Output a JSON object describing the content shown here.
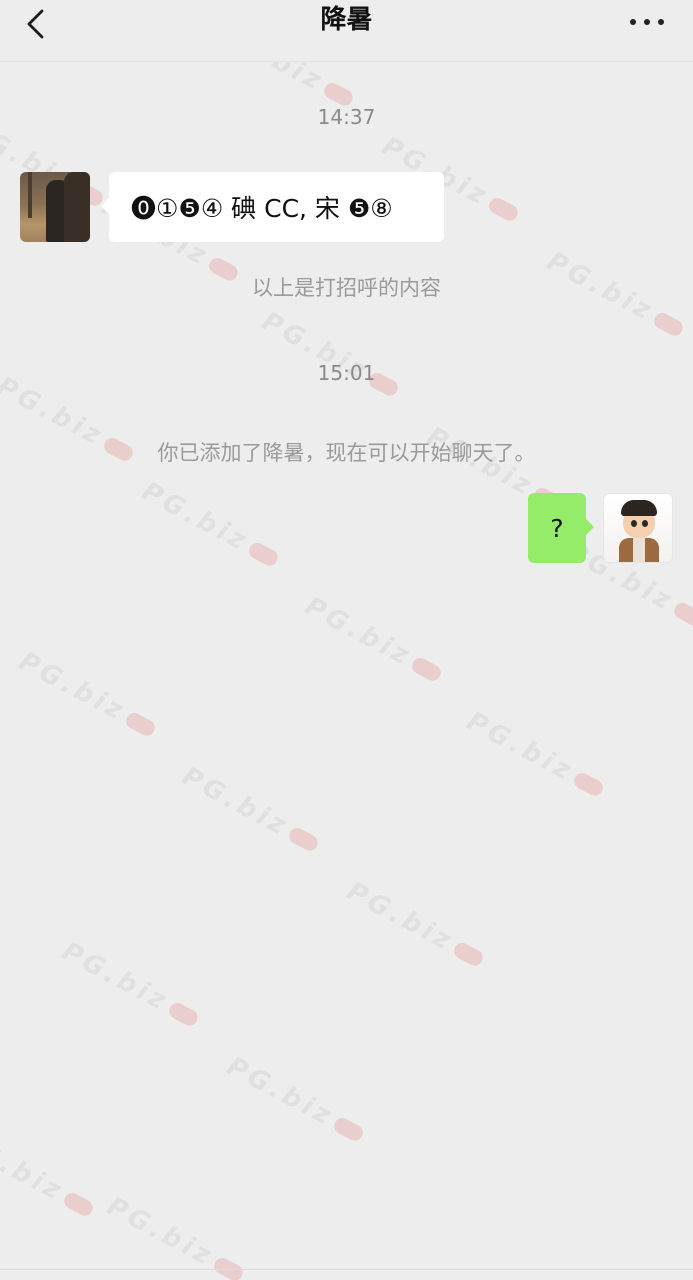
{
  "header": {
    "title": "降暑",
    "back_icon": "chevron-left-icon",
    "more_icon": "more-horizontal-icon"
  },
  "chat": {
    "timestamp_1": "14:37",
    "incoming_message": "⓿①❺④ 碘 CC, 宋 ❺⑧",
    "greeting_note": "以上是打招呼的内容",
    "timestamp_2": "15:01",
    "system_notice": "你已添加了降暑，现在可以开始聊天了。",
    "outgoing_message": "?"
  },
  "watermark": {
    "text": "PG.biz"
  },
  "colors": {
    "background": "#ededed",
    "incoming_bubble": "#ffffff",
    "outgoing_bubble": "#95ec69",
    "system_text": "#9a9a9a"
  }
}
